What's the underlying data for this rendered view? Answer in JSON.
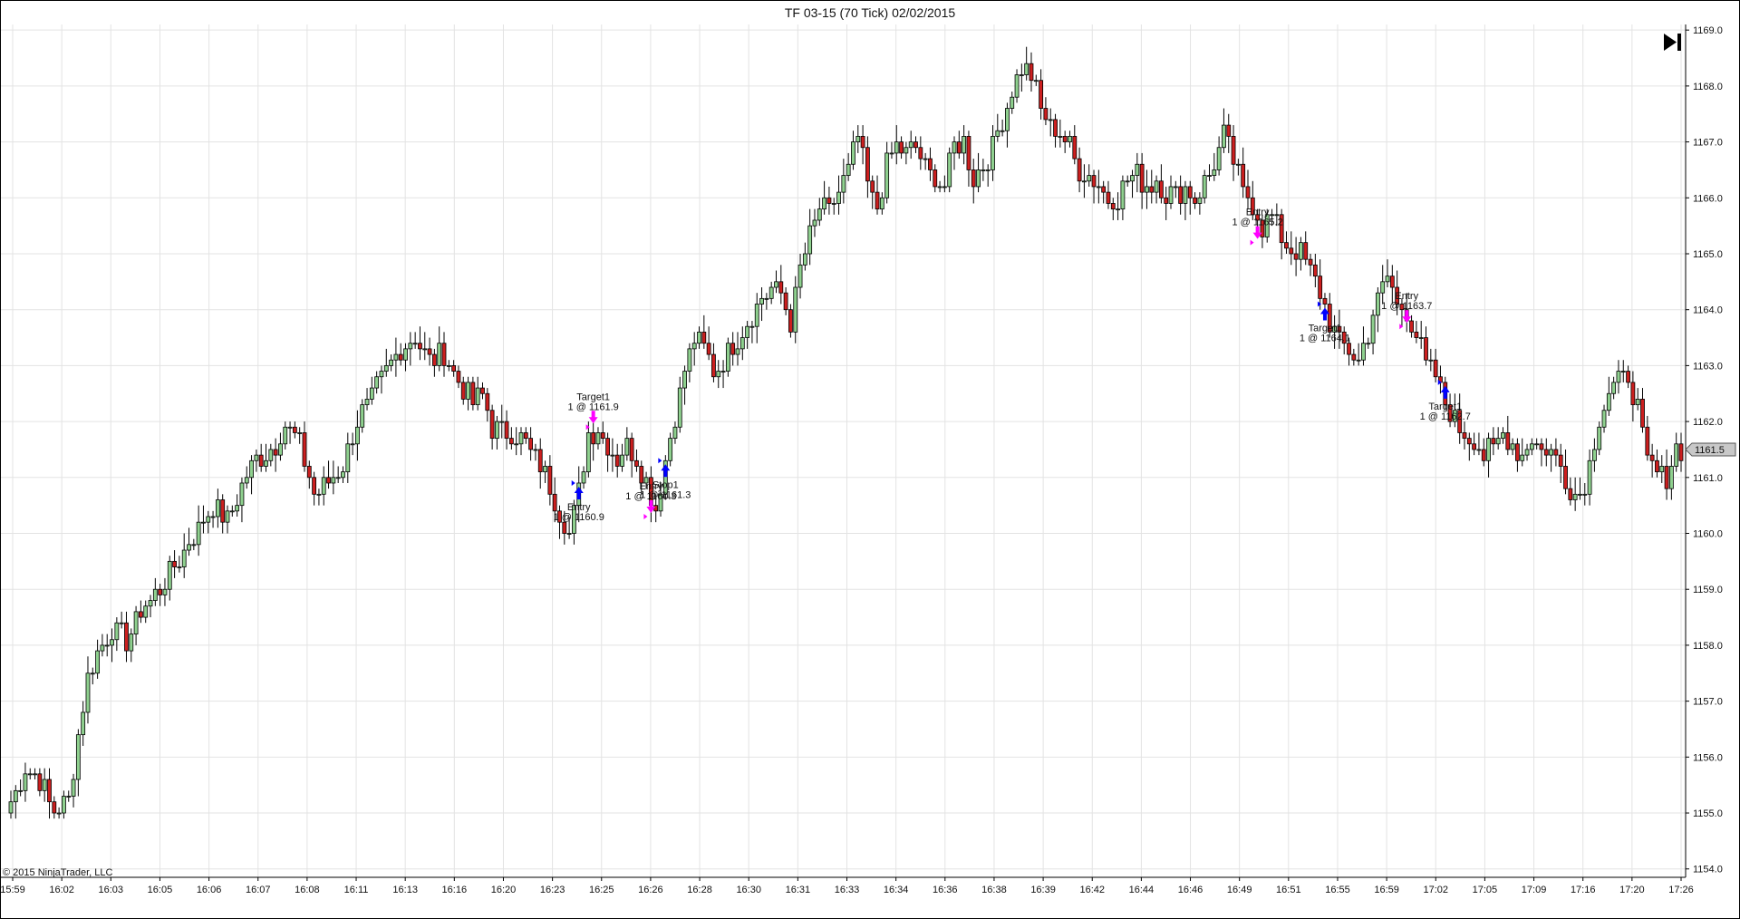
{
  "window": {
    "title": "TF 03-15 (70 Tick)  02/02/2015",
    "copyright": "© 2015 NinjaTrader, LLC"
  },
  "toolbar": {
    "scroll_to_end_icon": "skip-to-end-icon"
  },
  "chart_data": {
    "type": "candlestick",
    "title": "TF 03-15 (70 Tick)  02/02/2015",
    "ylim": [
      1153.85,
      1169.1
    ],
    "grid": true,
    "y_ticks": [
      "1154.0",
      "1155.0",
      "1156.0",
      "1157.0",
      "1158.0",
      "1159.0",
      "1160.0",
      "1161.0",
      "1162.0",
      "1163.0",
      "1164.0",
      "1165.0",
      "1166.0",
      "1167.0",
      "1168.0",
      "1169.0"
    ],
    "x_ticks": [
      "15:59",
      "16:02",
      "16:03",
      "16:05",
      "16:06",
      "16:07",
      "16:08",
      "16:11",
      "16:13",
      "16:16",
      "16:20",
      "16:23",
      "16:25",
      "16:26",
      "16:28",
      "16:30",
      "16:31",
      "16:33",
      "16:34",
      "16:36",
      "16:38",
      "16:39",
      "16:42",
      "16:44",
      "16:46",
      "16:49",
      "16:51",
      "16:55",
      "16:59",
      "17:02",
      "17:05",
      "17:09",
      "17:16",
      "17:20",
      "17:26"
    ],
    "last_price": "1161.5",
    "colors": {
      "up": "#8fd18f",
      "down": "#cc1f1f",
      "outline": "#000000",
      "grid": "#e3e3e3",
      "entry_arrow": "#0000ff",
      "exit_arrow": "#ff00ff",
      "price_marker": "#c8c8c8"
    },
    "anchors": [
      [
        0,
        1155.2
      ],
      [
        3,
        1155.8
      ],
      [
        6,
        1155.6
      ],
      [
        9,
        1155.0
      ],
      [
        12,
        1155.2
      ],
      [
        14,
        1156.4
      ],
      [
        16,
        1157.4
      ],
      [
        18,
        1157.9
      ],
      [
        21,
        1158.3
      ],
      [
        24,
        1158.1
      ],
      [
        27,
        1158.6
      ],
      [
        30,
        1158.9
      ],
      [
        33,
        1159.3
      ],
      [
        36,
        1159.7
      ],
      [
        39,
        1160.1
      ],
      [
        42,
        1160.5
      ],
      [
        45,
        1160.2
      ],
      [
        48,
        1160.9
      ],
      [
        51,
        1161.3
      ],
      [
        54,
        1161.5
      ],
      [
        57,
        1161.9
      ],
      [
        60,
        1161.6
      ],
      [
        63,
        1160.7
      ],
      [
        66,
        1160.9
      ],
      [
        69,
        1161.2
      ],
      [
        72,
        1162.0
      ],
      [
        75,
        1162.4
      ],
      [
        78,
        1162.9
      ],
      [
        81,
        1163.3
      ],
      [
        84,
        1163.5
      ],
      [
        87,
        1163.1
      ],
      [
        90,
        1163.2
      ],
      [
        93,
        1162.7
      ],
      [
        96,
        1162.3
      ],
      [
        98,
        1162.5
      ],
      [
        100,
        1161.9
      ],
      [
        103,
        1161.8
      ],
      [
        106,
        1161.7
      ],
      [
        109,
        1161.3
      ],
      [
        111,
        1161.1
      ],
      [
        114,
        1160.4
      ],
      [
        116,
        1160.0
      ],
      [
        118,
        1160.7
      ],
      [
        120,
        1161.8
      ],
      [
        122,
        1161.9
      ],
      [
        124,
        1161.6
      ],
      [
        126,
        1161.3
      ],
      [
        128,
        1161.6
      ],
      [
        130,
        1161.4
      ],
      [
        132,
        1160.9
      ],
      [
        134,
        1160.4
      ],
      [
        136,
        1161.3
      ],
      [
        138,
        1162.1
      ],
      [
        140,
        1162.9
      ],
      [
        142,
        1163.5
      ],
      [
        144,
        1163.3
      ],
      [
        146,
        1162.9
      ],
      [
        148,
        1163.1
      ],
      [
        150,
        1163.4
      ],
      [
        152,
        1163.6
      ],
      [
        154,
        1163.9
      ],
      [
        156,
        1164.2
      ],
      [
        158,
        1164.4
      ],
      [
        160,
        1164.3
      ],
      [
        162,
        1163.8
      ],
      [
        164,
        1164.7
      ],
      [
        166,
        1165.3
      ],
      [
        168,
        1165.8
      ],
      [
        170,
        1165.7
      ],
      [
        172,
        1166.1
      ],
      [
        174,
        1166.5
      ],
      [
        176,
        1167.1
      ],
      [
        178,
        1166.2
      ],
      [
        180,
        1165.8
      ],
      [
        182,
        1166.6
      ],
      [
        184,
        1166.9
      ],
      [
        186,
        1166.8
      ],
      [
        188,
        1166.9
      ],
      [
        190,
        1166.5
      ],
      [
        192,
        1166.4
      ],
      [
        194,
        1166.2
      ],
      [
        196,
        1166.9
      ],
      [
        198,
        1167.0
      ],
      [
        200,
        1166.3
      ],
      [
        202,
        1166.6
      ],
      [
        204,
        1166.9
      ],
      [
        206,
        1167.4
      ],
      [
        208,
        1167.9
      ],
      [
        210,
        1168.3
      ],
      [
        212,
        1168.2
      ],
      [
        214,
        1167.6
      ],
      [
        216,
        1167.3
      ],
      [
        218,
        1167.2
      ],
      [
        220,
        1166.9
      ],
      [
        222,
        1166.5
      ],
      [
        224,
        1166.4
      ],
      [
        226,
        1166.2
      ],
      [
        228,
        1166.0
      ],
      [
        230,
        1166.0
      ],
      [
        232,
        1166.3
      ],
      [
        234,
        1166.4
      ],
      [
        236,
        1166.2
      ],
      [
        238,
        1166.3
      ],
      [
        240,
        1166.1
      ],
      [
        242,
        1166.0
      ],
      [
        244,
        1166.2
      ],
      [
        246,
        1166.0
      ],
      [
        248,
        1166.3
      ],
      [
        250,
        1166.6
      ],
      [
        252,
        1167.1
      ],
      [
        254,
        1166.7
      ],
      [
        256,
        1166.1
      ],
      [
        258,
        1165.9
      ],
      [
        260,
        1165.5
      ],
      [
        262,
        1165.7
      ],
      [
        264,
        1165.3
      ],
      [
        266,
        1165.1
      ],
      [
        268,
        1165.0
      ],
      [
        270,
        1164.7
      ],
      [
        272,
        1164.3
      ],
      [
        274,
        1163.8
      ],
      [
        276,
        1163.4
      ],
      [
        278,
        1163.3
      ],
      [
        280,
        1163.1
      ],
      [
        282,
        1163.6
      ],
      [
        284,
        1164.2
      ],
      [
        286,
        1164.6
      ],
      [
        288,
        1164.1
      ],
      [
        290,
        1164.0
      ],
      [
        292,
        1163.6
      ],
      [
        294,
        1163.0
      ],
      [
        296,
        1162.8
      ],
      [
        298,
        1162.3
      ],
      [
        300,
        1162.0
      ],
      [
        302,
        1161.8
      ],
      [
        304,
        1161.7
      ],
      [
        306,
        1161.4
      ],
      [
        308,
        1161.5
      ],
      [
        310,
        1161.8
      ],
      [
        312,
        1161.6
      ],
      [
        314,
        1161.4
      ],
      [
        316,
        1161.7
      ],
      [
        318,
        1161.5
      ],
      [
        320,
        1161.5
      ],
      [
        322,
        1161.2
      ],
      [
        324,
        1160.8
      ],
      [
        326,
        1160.7
      ],
      [
        328,
        1161.2
      ],
      [
        330,
        1162.1
      ],
      [
        332,
        1162.5
      ],
      [
        334,
        1162.7
      ],
      [
        336,
        1162.8
      ],
      [
        338,
        1162.2
      ],
      [
        340,
        1161.2
      ],
      [
        342,
        1161.1
      ],
      [
        344,
        1161.0
      ],
      [
        346,
        1161.5
      ],
      [
        347,
        1161.5
      ]
    ],
    "trades": [
      {
        "bar": 118,
        "price": 1160.9,
        "dir": "long",
        "labels": [
          "Entry",
          "1 @ 1160.9"
        ]
      },
      {
        "bar": 121,
        "price": 1161.9,
        "dir": "exit-long",
        "labels": [
          "Target1",
          "1 @ 1161.9"
        ]
      },
      {
        "bar": 133,
        "price": 1160.3,
        "dir": "short",
        "labels": [
          "Entry",
          "1 @ 1160.3"
        ]
      },
      {
        "bar": 136,
        "price": 1161.3,
        "dir": "exit-short",
        "labels": [
          "Stop1",
          "1 @ 1161.3"
        ]
      },
      {
        "bar": 259,
        "price": 1165.2,
        "dir": "short",
        "labels": [
          "Entry",
          "1 @ 1165.2"
        ]
      },
      {
        "bar": 273,
        "price": 1164.1,
        "dir": "exit-short",
        "labels": [
          "Target1",
          "1 @ 1164.1"
        ]
      },
      {
        "bar": 290,
        "price": 1163.7,
        "dir": "short",
        "labels": [
          "Entry",
          "1 @ 1163.7"
        ]
      },
      {
        "bar": 298,
        "price": 1162.7,
        "dir": "exit-short",
        "labels": [
          "Target1",
          "1 @ 1162.7"
        ]
      }
    ]
  }
}
